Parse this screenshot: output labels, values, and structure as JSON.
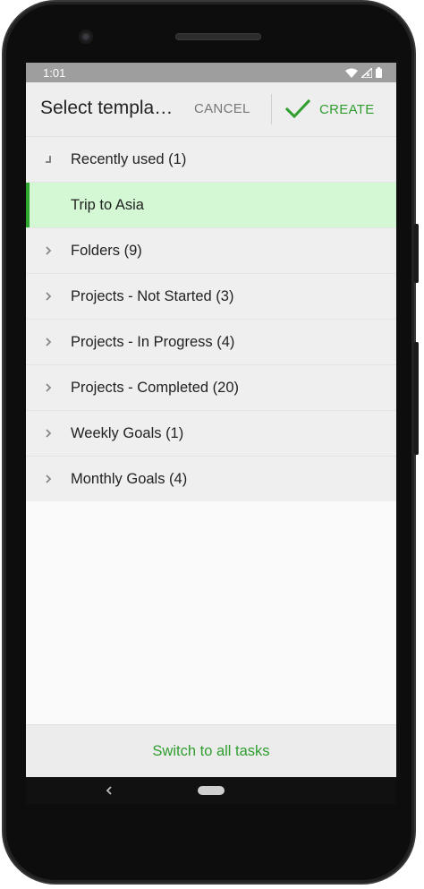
{
  "status_bar": {
    "time": "1:01",
    "icons": [
      "wifi-icon",
      "signal-icon",
      "battery-icon"
    ]
  },
  "app_bar": {
    "title": "Select templa…",
    "cancel_label": "CANCEL",
    "create_label": "CREATE",
    "create_icon": "checkmark-icon"
  },
  "list": {
    "items": [
      {
        "label": "Recently used (1)",
        "icon": "expanded-corner-icon",
        "state": "expanded"
      },
      {
        "label": "Trip to Asia",
        "icon": "",
        "state": "selected"
      },
      {
        "label": "Folders (9)",
        "icon": "chevron-right-icon",
        "state": "collapsed"
      },
      {
        "label": "Projects - Not Started (3)",
        "icon": "chevron-right-icon",
        "state": "collapsed"
      },
      {
        "label": "Projects - In Progress (4)",
        "icon": "chevron-right-icon",
        "state": "collapsed"
      },
      {
        "label": "Projects - Completed (20)",
        "icon": "chevron-right-icon",
        "state": "collapsed"
      },
      {
        "label": "Weekly Goals (1)",
        "icon": "chevron-right-icon",
        "state": "collapsed"
      },
      {
        "label": "Monthly Goals (4)",
        "icon": "chevron-right-icon",
        "state": "collapsed"
      }
    ]
  },
  "footer": {
    "switch_label": "Switch to all tasks"
  },
  "colors": {
    "accent_green": "#2f9e2f",
    "selected_bg": "#d4f7d4",
    "status_bar_bg": "#9e9e9e"
  }
}
